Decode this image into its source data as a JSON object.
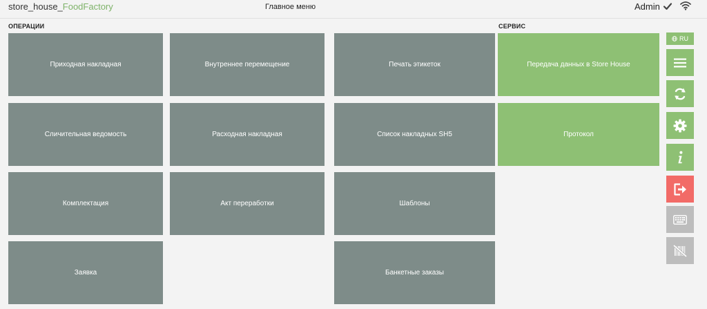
{
  "header": {
    "app_title_main": "store_house_",
    "app_title_accent": "FoodFactory",
    "menu_title": "Главное меню",
    "user": "Admin"
  },
  "sections": {
    "operations": "ОПЕРАЦИИ",
    "service": "СЕРВИС"
  },
  "tiles": {
    "incoming_invoice": "Приходная накладная",
    "internal_transfer": "Внутреннее перемещение",
    "print_labels": "Печать этикеток",
    "data_transfer": "Передача данных в Store House",
    "inventory_statement": "Сличительная ведомость",
    "outgoing_invoice": "Расходная накладная",
    "sh5_invoice_list": "Список накладных SH5",
    "protocol": "Протокол",
    "assembly": "Комплектация",
    "processing_act": "Акт переработки",
    "templates": "Шаблоны",
    "request": "Заявка",
    "banquet_orders": "Банкетные заказы"
  },
  "sidebar": {
    "language": "RU",
    "icons": [
      "globe-icon",
      "menu-icon",
      "sync-icon",
      "gear-icon",
      "info-icon",
      "logout-icon",
      "keyboard-icon",
      "barcode-off-icon"
    ]
  },
  "colors": {
    "tile_gray": "#7e8c89",
    "tile_green": "#8ec074",
    "logout_red": "#f26b67",
    "disabled_gray": "#bdbdbd",
    "accent_text": "#7fb36a"
  }
}
